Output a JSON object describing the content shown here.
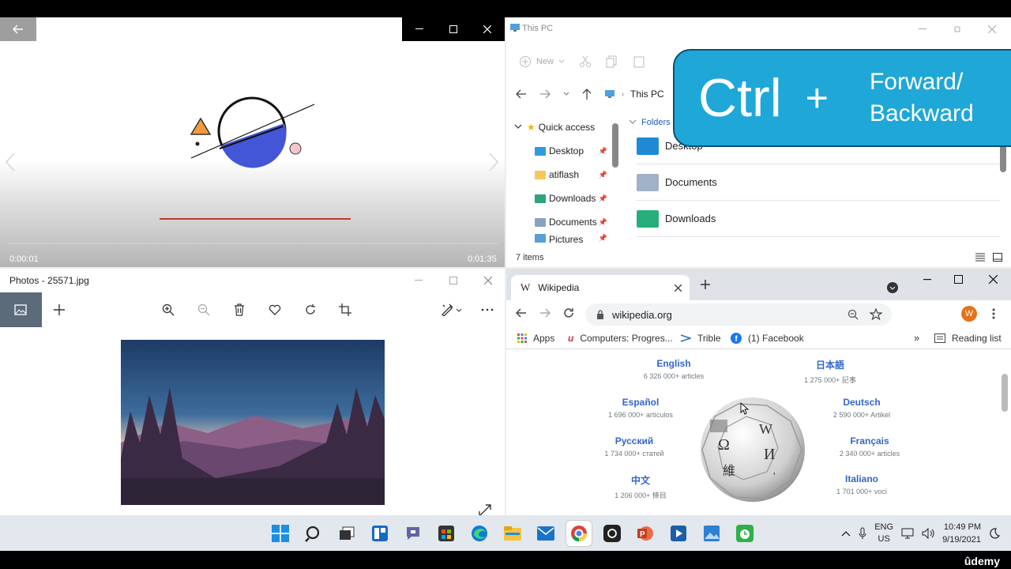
{
  "video": {
    "time_current": "0:00:01",
    "time_total": "0:01:35",
    "progress_fraction": 0.01
  },
  "photos": {
    "title": "Photos - 25571.jpg",
    "toolbar": [
      "image-icon",
      "add-icon",
      "zoom-in-icon",
      "zoom-out-icon",
      "delete-icon",
      "heart-icon",
      "rotate-icon",
      "crop-icon",
      "edit-icon",
      "more-icon"
    ]
  },
  "explorer": {
    "title": "This PC",
    "ribbon_new": "New",
    "address": "This PC",
    "nav": [
      {
        "label": "Quick access"
      },
      {
        "label": "Desktop"
      },
      {
        "label": "atiflash"
      },
      {
        "label": "Downloads"
      },
      {
        "label": "Documents"
      },
      {
        "label": "Pictures"
      }
    ],
    "section": "Folders",
    "folders": [
      {
        "label": "Desktop"
      },
      {
        "label": "Documents"
      },
      {
        "label": "Downloads"
      }
    ],
    "status": "7 items"
  },
  "chrome": {
    "tab_title": "Wikipedia",
    "tab_icon": "W",
    "url": "wikipedia.org",
    "avatar": "W",
    "bookmarks": [
      {
        "label": "Apps"
      },
      {
        "label": "Computers: Progres..."
      },
      {
        "label": "Trible"
      },
      {
        "label": "(1) Facebook"
      }
    ],
    "reading_list": "Reading list",
    "languages": [
      {
        "name": "English",
        "count": "6 326 000+ articles"
      },
      {
        "name": "日本語",
        "count": "1 275 000+ 記事"
      },
      {
        "name": "Español",
        "count": "1 696 000+ artículos"
      },
      {
        "name": "Deutsch",
        "count": "2 590 000+ Artikel"
      },
      {
        "name": "Русский",
        "count": "1 734 000+ статей"
      },
      {
        "name": "Français",
        "count": "2 340 000+ articles"
      },
      {
        "name": "中文",
        "count": "1 206 000+ 條目"
      },
      {
        "name": "Italiano",
        "count": "1 701 000+ voci"
      }
    ]
  },
  "overlay": {
    "key": "Ctrl",
    "plus": "+",
    "line1": "Forward/",
    "line2": "Backward",
    "color": "#1fa7d8"
  },
  "taskbar": {
    "lang": "ENG",
    "region": "US",
    "time": "10:49 PM",
    "date": "9/19/2021"
  },
  "watermark": "ûdemy"
}
